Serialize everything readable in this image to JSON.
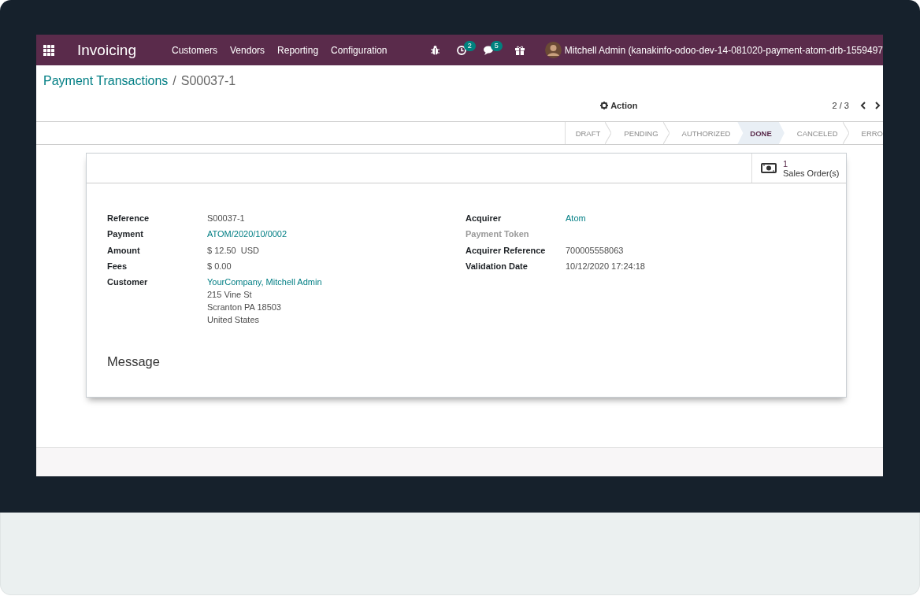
{
  "navbar": {
    "app_name": "Invoicing",
    "menu": [
      "Customers",
      "Vendors",
      "Reporting",
      "Configuration"
    ],
    "activity_count": "2",
    "message_count": "5",
    "user": "Mitchell Admin (kanakinfo-odoo-dev-14-081020-payment-atom-drb-1559497"
  },
  "breadcrumb_separator": "/",
  "breadcrumb": [
    {
      "label": "Payment Transactions",
      "kind": "link"
    },
    {
      "label": "S00037-1",
      "kind": "current"
    }
  ],
  "action_menu": "Action",
  "pager": "2 / 3",
  "statusbar": [
    {
      "label": "DRAFT",
      "selected": false
    },
    {
      "label": "PENDING",
      "selected": false
    },
    {
      "label": "AUTHORIZED",
      "selected": false
    },
    {
      "label": "DONE",
      "selected": true
    },
    {
      "label": "CANCELED",
      "selected": false
    },
    {
      "label": "ERRO",
      "selected": false
    }
  ],
  "smart_button": {
    "count": "1",
    "label": "Sales Order(s)"
  },
  "fields_left": [
    {
      "label": "Reference",
      "value": "S00037-1",
      "kind": "text",
      "muted": false
    },
    {
      "label": "Payment",
      "value": "ATOM/2020/10/0002",
      "kind": "link",
      "muted": false
    },
    {
      "label": "Amount",
      "value": "$ 12.50  USD",
      "kind": "text",
      "muted": false
    },
    {
      "label": "Fees",
      "value": "$ 0.00",
      "kind": "text",
      "muted": false
    },
    {
      "label": "Customer",
      "value": "YourCompany, Mitchell Admin",
      "kind": "link",
      "muted": false,
      "lines": [
        "215 Vine St",
        "Scranton PA 18503",
        "United States"
      ]
    }
  ],
  "fields_right": [
    {
      "label": "Acquirer",
      "value": "Atom",
      "kind": "link",
      "muted": false
    },
    {
      "label": "Payment Token",
      "muted": true
    },
    {
      "label": "Acquirer Reference",
      "value": "700005558063",
      "kind": "text",
      "muted": false
    },
    {
      "label": "Validation Date",
      "value": "10/12/2020 17:24:18",
      "kind": "text",
      "muted": false
    }
  ],
  "message_heading": "Message"
}
